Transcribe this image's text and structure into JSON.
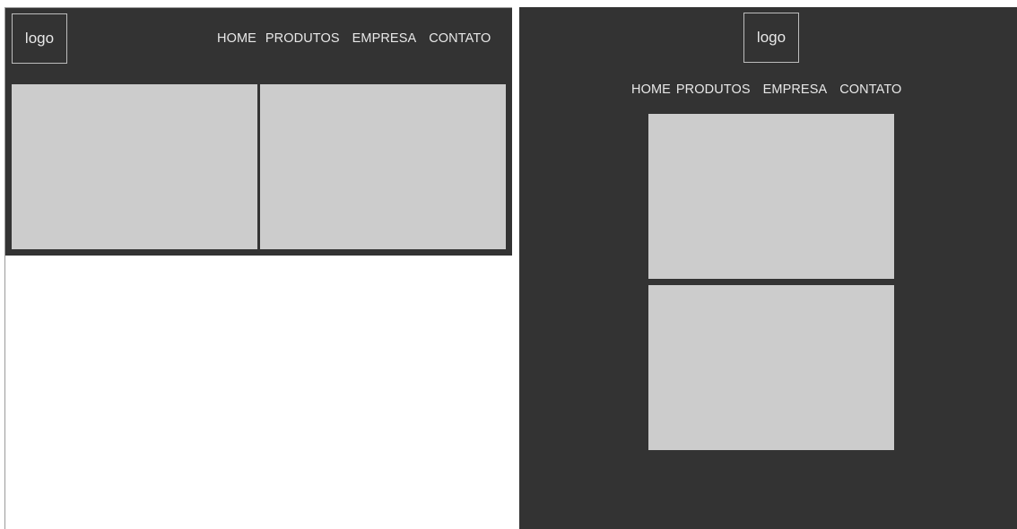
{
  "desktop": {
    "logo": "logo",
    "nav": [
      "HOME",
      "PRODUTOS",
      "EMPRESA",
      "CONTATO"
    ]
  },
  "mobile": {
    "logo": "logo",
    "nav": [
      "HOME",
      "PRODUTOS",
      "EMPRESA",
      "CONTATO"
    ]
  },
  "colors": {
    "header_bg": "#333333",
    "card_bg": "#cccccc",
    "text": "#e8e8e8"
  }
}
